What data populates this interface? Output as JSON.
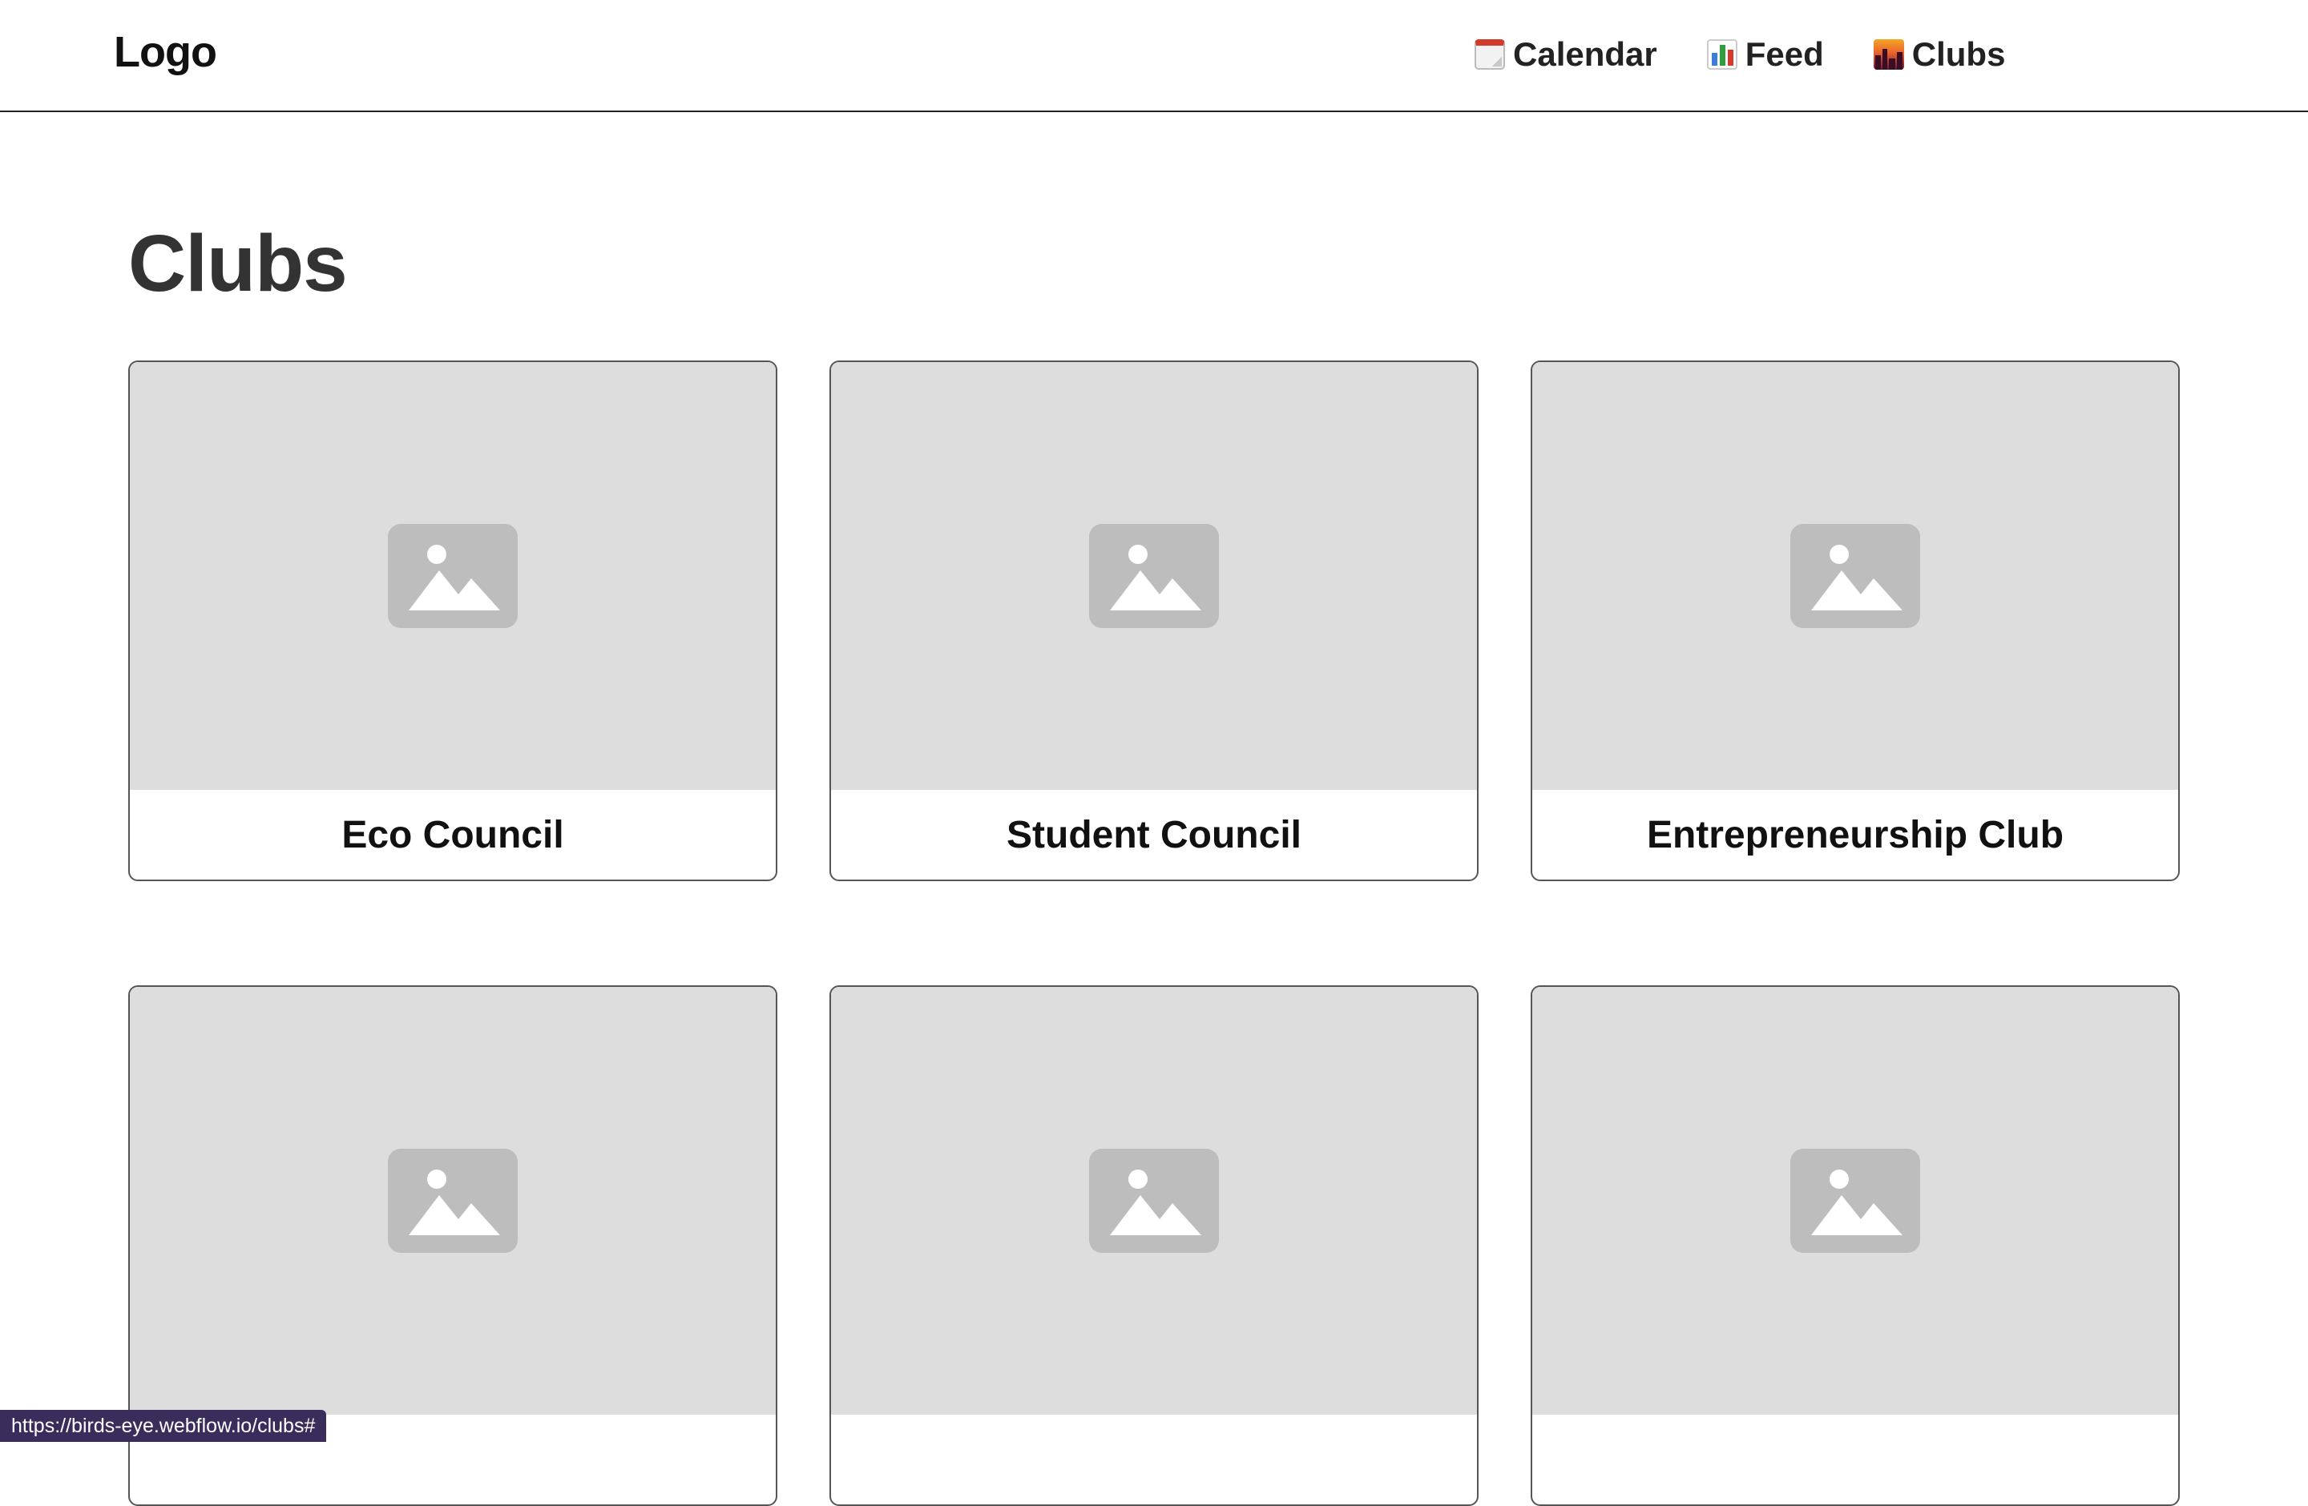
{
  "header": {
    "logo": "Logo",
    "nav": [
      {
        "label": "Calendar",
        "icon": "calendar-icon"
      },
      {
        "label": "Feed",
        "icon": "bar-chart-icon"
      },
      {
        "label": "Clubs",
        "icon": "city-sunset-icon"
      }
    ]
  },
  "main": {
    "title": "Clubs",
    "cards": [
      {
        "title": "Eco Council",
        "image": "placeholder-image-icon"
      },
      {
        "title": "Student Council",
        "image": "placeholder-image-icon"
      },
      {
        "title": "Entrepreneurship Club",
        "image": "placeholder-image-icon"
      },
      {
        "title": "",
        "image": "placeholder-image-icon"
      },
      {
        "title": "",
        "image": "placeholder-image-icon"
      },
      {
        "title": "",
        "image": "placeholder-image-icon"
      }
    ]
  },
  "status_bar": {
    "url": "https://birds-eye.webflow.io/clubs#"
  },
  "colors": {
    "placeholder_bg": "#dddddd",
    "placeholder_icon": "#bdbdbd",
    "status_bar_bg": "#3a2d5c"
  }
}
